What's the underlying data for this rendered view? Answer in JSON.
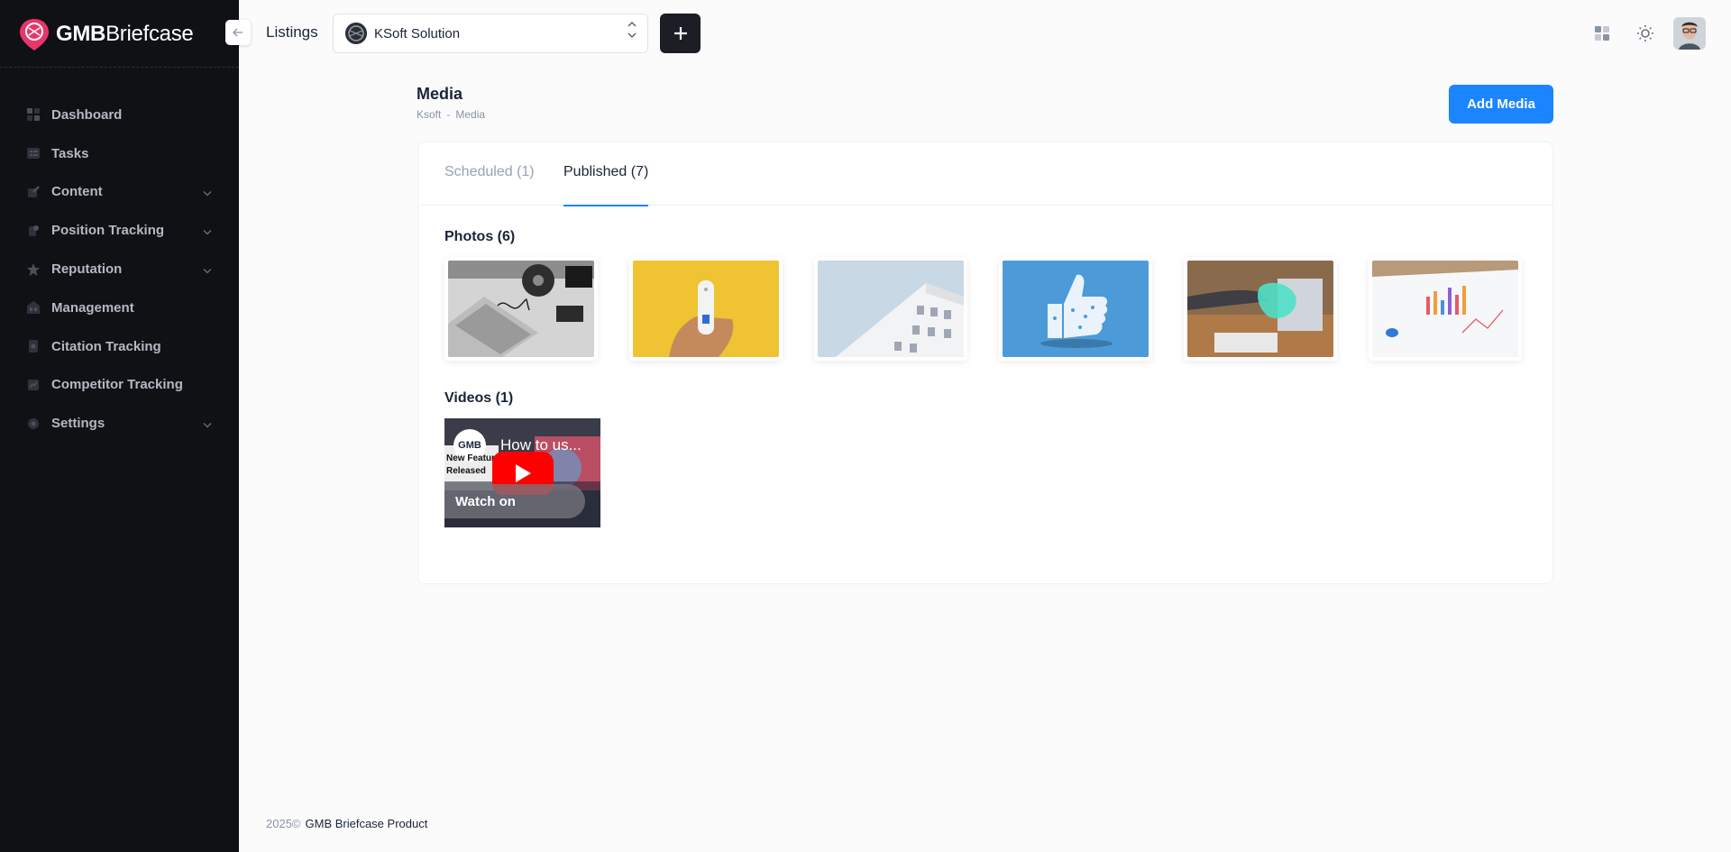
{
  "app": {
    "logo_bold": "GMB",
    "logo_regular": "Briefcase"
  },
  "sidebar": {
    "items": [
      {
        "label": "Dashboard",
        "icon": "dashboard-icon",
        "has_children": false
      },
      {
        "label": "Tasks",
        "icon": "tasks-icon",
        "has_children": false
      },
      {
        "label": "Content",
        "icon": "content-icon",
        "has_children": true
      },
      {
        "label": "Position Tracking",
        "icon": "position-tracking-icon",
        "has_children": true
      },
      {
        "label": "Reputation",
        "icon": "reputation-icon",
        "has_children": true
      },
      {
        "label": "Management",
        "icon": "management-icon",
        "has_children": false
      },
      {
        "label": "Citation Tracking",
        "icon": "citation-icon",
        "has_children": false
      },
      {
        "label": "Competitor Tracking",
        "icon": "competitor-icon",
        "has_children": false
      },
      {
        "label": "Settings",
        "icon": "settings-icon",
        "has_children": true
      }
    ]
  },
  "header": {
    "listings_label": "Listings",
    "selected_listing": "KSoft Solution"
  },
  "page": {
    "title": "Media",
    "breadcrumb": [
      "Ksoft",
      "-",
      "Media"
    ],
    "add_button": "Add Media"
  },
  "tabs": [
    {
      "label": "Scheduled (1)",
      "active": false
    },
    {
      "label": "Published (7)",
      "active": true
    }
  ],
  "photos": {
    "title": "Photos (6)",
    "items": [
      {
        "name": "desk-turntable-laptop-photo"
      },
      {
        "name": "hand-device-yellow-photo"
      },
      {
        "name": "white-building-sky-photo"
      },
      {
        "name": "social-thumbs-up-photo"
      },
      {
        "name": "hand-laptop-data-photo"
      },
      {
        "name": "charts-papers-photo"
      }
    ]
  },
  "videos": {
    "title": "Videos (1)",
    "items": [
      {
        "title": "How to us...",
        "channel_logo": "GMB",
        "watch_label": "Watch on",
        "overlay_text": "New Feature Released"
      }
    ]
  },
  "footer": {
    "year": "2025©",
    "label": "GMB Briefcase Product"
  },
  "colors": {
    "sidebar_bg": "#0f1115",
    "accent": "#1b84ff",
    "dark_button": "#1b1e24",
    "logo_pink": "#e8356b"
  }
}
